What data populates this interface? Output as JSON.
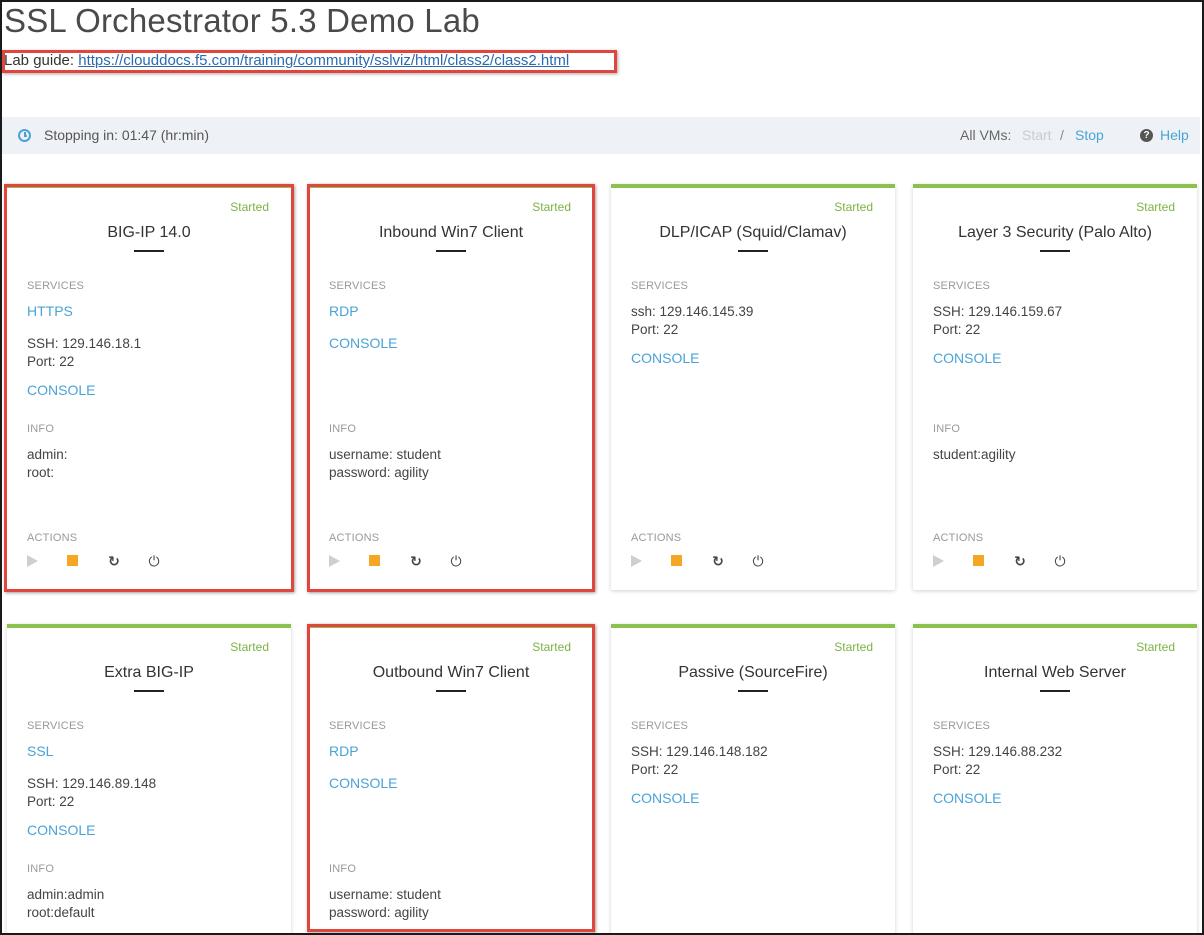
{
  "page": {
    "title": "SSL Orchestrator 5.3 Demo Lab",
    "guide_label": "Lab guide: ",
    "guide_url": "https://clouddocs.f5.com/training/community/sslviz/html/class2/class2.html"
  },
  "statusbar": {
    "stopping_text": "Stopping in: 01:47 (hr:min)",
    "all_vms_label": "All VMs:",
    "start_label": "Start",
    "slash": "/",
    "stop_label": "Stop",
    "help_label": "Help"
  },
  "section_labels": {
    "services": "SERVICES",
    "info": "INFO",
    "actions": "ACTIONS"
  },
  "cards": [
    {
      "name": "BIG-IP 14.0",
      "state": "Started",
      "services": {
        "link1": "HTTPS",
        "ssh": "SSH: 129.146.18.1",
        "port": "Port: 22",
        "console": "CONSOLE"
      },
      "info": [
        "admin:",
        "root:"
      ]
    },
    {
      "name": "Inbound Win7 Client",
      "state": "Started",
      "services": {
        "link1": "RDP",
        "console": "CONSOLE"
      },
      "info": [
        "username: student",
        "password: agility"
      ]
    },
    {
      "name": "DLP/ICAP (Squid/Clamav)",
      "state": "Started",
      "services": {
        "ssh": "ssh: 129.146.145.39",
        "port": "Port: 22",
        "console": "CONSOLE"
      },
      "info": []
    },
    {
      "name": "Layer 3 Security (Palo Alto)",
      "state": "Started",
      "services": {
        "ssh": "SSH: 129.146.159.67",
        "port": "Port: 22",
        "console": "CONSOLE"
      },
      "info": [
        "student:agility"
      ]
    },
    {
      "name": "Extra BIG-IP",
      "state": "Started",
      "services": {
        "link1": "SSL",
        "ssh": "SSH: 129.146.89.148",
        "port": "Port: 22",
        "console": "CONSOLE"
      },
      "info": [
        "admin:admin",
        "root:default"
      ]
    },
    {
      "name": "Outbound Win7 Client",
      "state": "Started",
      "services": {
        "link1": "RDP",
        "console": "CONSOLE"
      },
      "info": [
        "username: student",
        "password: agility"
      ]
    },
    {
      "name": "Passive (SourceFire)",
      "state": "Started",
      "services": {
        "ssh": "SSH: 129.146.148.182",
        "port": "Port: 22",
        "console": "CONSOLE"
      },
      "info": []
    },
    {
      "name": "Internal Web Server",
      "state": "Started",
      "services": {
        "ssh": "SSH: 129.146.88.232",
        "port": "Port: 22",
        "console": "CONSOLE"
      },
      "info": []
    }
  ],
  "icons": {
    "clock": "clock-icon",
    "help": "help-circle-icon",
    "play": "play-icon",
    "stop": "stop-icon",
    "refresh": "refresh-icon",
    "power": "power-icon"
  },
  "colors": {
    "accent": "#4aa3d6",
    "started": "#7cb342",
    "card_border": "#8cc152",
    "stop_action": "#f5a623",
    "highlight": "#e0463e"
  }
}
